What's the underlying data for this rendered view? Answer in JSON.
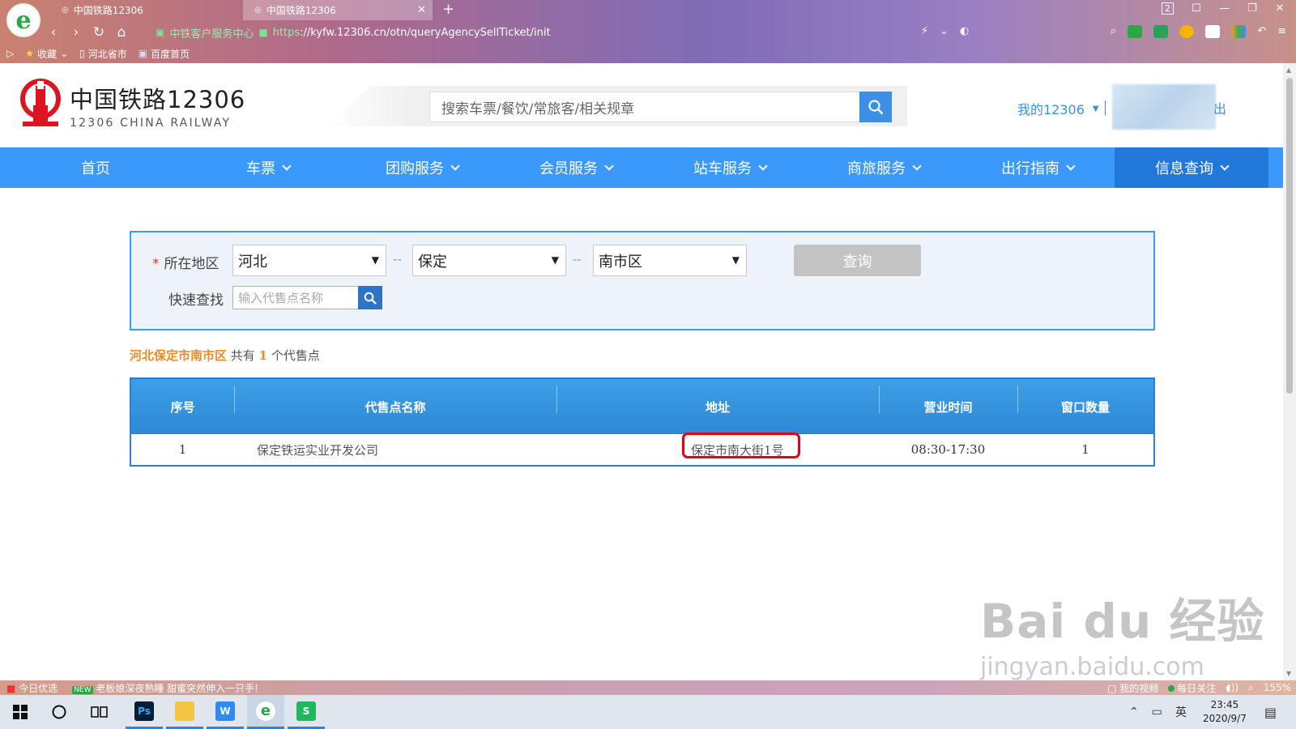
{
  "browser": {
    "tabs": [
      {
        "label": "中国铁路12306",
        "active": false
      },
      {
        "label": "中国铁路12306",
        "active": true
      }
    ],
    "new_tab": "+",
    "tab_count": "2",
    "cert_label": "中铁客户服务中心",
    "url_protocol": "https",
    "url_rest": "://kyfw.12306.cn/otn/queryAgencySellTicket/init",
    "bookmarks": [
      "收藏",
      "河北省市",
      "百度首页"
    ]
  },
  "site": {
    "logo_cn": "中国铁路12306",
    "logo_en": "12306 CHINA RAILWAY",
    "search_placeholder": "搜索车票/餐饮/常旅客/相关规章",
    "my12306": "我的12306",
    "logout": "出"
  },
  "nav": {
    "items": [
      {
        "label": "首页",
        "has_menu": false
      },
      {
        "label": "车票",
        "has_menu": true
      },
      {
        "label": "团购服务",
        "has_menu": true
      },
      {
        "label": "会员服务",
        "has_menu": true
      },
      {
        "label": "站车服务",
        "has_menu": true
      },
      {
        "label": "商旅服务",
        "has_menu": true
      },
      {
        "label": "出行指南",
        "has_menu": true
      },
      {
        "label": "信息查询",
        "has_menu": true,
        "active": true
      }
    ]
  },
  "query": {
    "required_mark": "*",
    "region_label": "所在地区",
    "province": "河北",
    "city": "保定",
    "district": "南市区",
    "separator": "--",
    "query_button": "查询",
    "quick_label": "快速查找",
    "quick_placeholder": "输入代售点名称"
  },
  "summary": {
    "location": "河北保定市南市区",
    "prefix": "共有",
    "count": "1",
    "suffix": "个代售点"
  },
  "table": {
    "headers": [
      "序号",
      "代售点名称",
      "地址",
      "营业时间",
      "窗口数量"
    ],
    "rows": [
      {
        "index": "1",
        "name": "保定铁运实业开发公司",
        "address": "保定市南大街1号",
        "hours": "08:30-17:30",
        "windows": "1"
      }
    ]
  },
  "statusbar": {
    "left_1": "今日优选",
    "left_2": "老板娘深夜熟睡 甜蜜突然伸入一只手!",
    "new_badge": "NEW",
    "right_1": "我的视频",
    "right_2": "每日关注",
    "zoom": "155%"
  },
  "taskbar": {
    "time": "23:45",
    "date": "2020/9/7",
    "ime": "英"
  },
  "watermark": {
    "line1": "Bai du 经验",
    "line2": "jingyan.baidu.com"
  },
  "colors": {
    "primary_blue": "#3b99fc",
    "active_nav": "#2278d8",
    "highlight_red": "#e60012",
    "summary_orange": "#f08a24"
  }
}
